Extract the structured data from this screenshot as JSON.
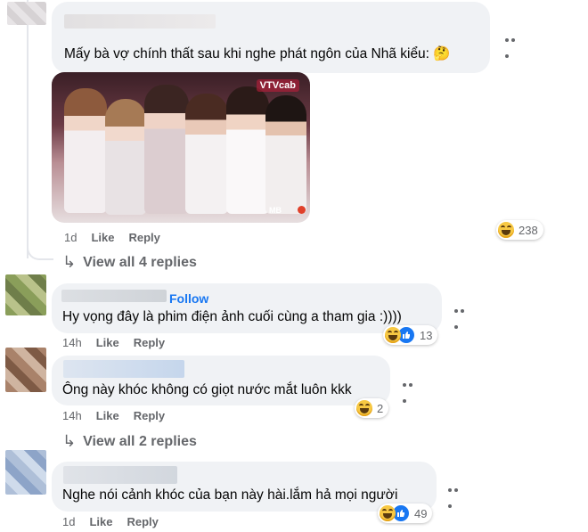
{
  "comments": [
    {
      "text": "Mấy bà vợ chính thất sau khi nghe phát ngôn của Nhã kiểu:",
      "emoji": "🤔",
      "time": "1d",
      "like": "Like",
      "reply": "Reply",
      "reaction_count": "238",
      "view_replies": "View all 4 replies",
      "image_channel": "VTVcab",
      "image_watermark": "MB"
    },
    {
      "follow": "Follow",
      "text": "Hy vọng đây là phim điện ảnh cuối cùng a tham gia :))))",
      "time": "14h",
      "like": "Like",
      "reply": "Reply",
      "reaction_count": "13"
    },
    {
      "text": "Ông này khóc không có giọt nước mắt luôn kkk",
      "time": "14h",
      "like": "Like",
      "reply": "Reply",
      "reaction_count": "2",
      "view_replies": "View all 2 replies"
    },
    {
      "text": "Nghe nói cảnh khóc của bạn này hài.lắm hả mọi người",
      "time": "1d",
      "like": "Like",
      "reply": "Reply",
      "reaction_count": "49"
    }
  ],
  "colors": {
    "accent": "#1877f2",
    "bubble": "#f0f2f5",
    "meta": "#65676b"
  }
}
